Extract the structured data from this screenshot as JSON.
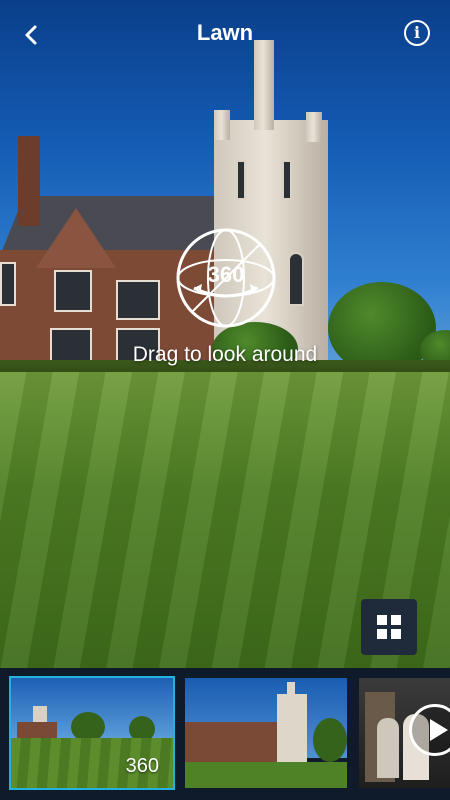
{
  "header": {
    "title": "Lawn"
  },
  "hint": {
    "badge": "360",
    "text": "Drag to look around"
  },
  "thumbnails": [
    {
      "label": "360",
      "active": true
    },
    {
      "label": "",
      "active": false
    },
    {
      "label": "",
      "active": false
    }
  ],
  "colors": {
    "accent": "#23b2dc",
    "strip_bg": "#0f1a2b",
    "grid_button_bg": "#1f2a3a"
  }
}
